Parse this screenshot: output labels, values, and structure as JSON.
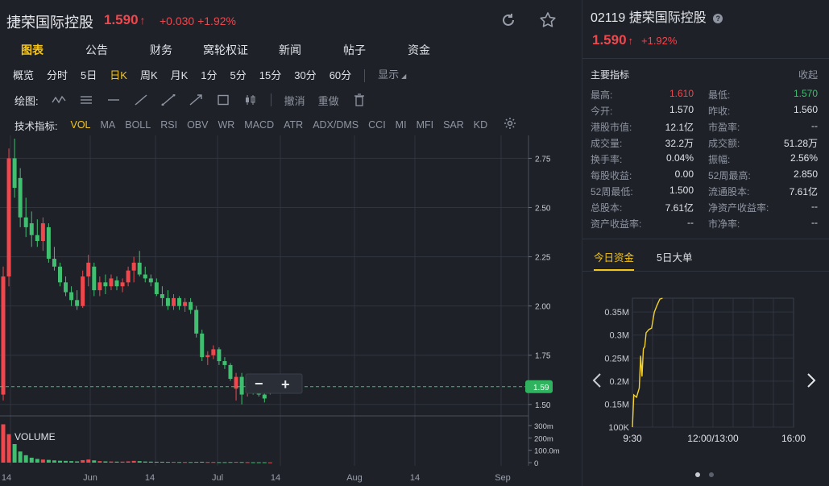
{
  "header": {
    "stock_name": "捷荣国际控股",
    "price": "1.590",
    "price_arrow": "↑",
    "change": "+0.030 +1.92%"
  },
  "main_tabs": [
    {
      "label": "图表",
      "active": true
    },
    {
      "label": "公告"
    },
    {
      "label": "财务"
    },
    {
      "label": "窝轮权证"
    },
    {
      "label": "新闻"
    },
    {
      "label": "帖子"
    },
    {
      "label": "资金"
    }
  ],
  "periods": [
    {
      "label": "概览"
    },
    {
      "label": "分时"
    },
    {
      "label": "5日"
    },
    {
      "label": "日K",
      "active": true
    },
    {
      "label": "周K"
    },
    {
      "label": "月K"
    },
    {
      "label": "1分"
    },
    {
      "label": "5分"
    },
    {
      "label": "15分"
    },
    {
      "label": "30分"
    },
    {
      "label": "60分"
    }
  ],
  "display_label": "显示",
  "draw_bar": {
    "label": "绘图:",
    "undo": "撤消",
    "redo": "重做"
  },
  "indicators": {
    "label": "技术指标:",
    "items": [
      "VOL",
      "MA",
      "BOLL",
      "RSI",
      "OBV",
      "WR",
      "MACD",
      "ATR",
      "ADX/DMS",
      "CCI",
      "MI",
      "MFI",
      "SAR",
      "KD"
    ],
    "active": "VOL"
  },
  "chart": {
    "price_ticks": [
      "2.75",
      "2.50",
      "2.25",
      "2.00",
      "1.75",
      "1.50"
    ],
    "current_price_tag": "1.59",
    "volume_label": "VOLUME",
    "volume_ticks": [
      "300m",
      "200m",
      "100.0m",
      "0"
    ],
    "x_labels": [
      "14",
      "Jun",
      "14",
      "Jul",
      "14",
      "Aug",
      "14",
      "Sep"
    ],
    "zoom_out": "−",
    "zoom_in": "+"
  },
  "chart_data": {
    "type": "candlestick",
    "price_axis": [
      1.45,
      2.85
    ],
    "volume_axis_m": [
      0,
      300
    ],
    "candles": [
      {
        "o": 1.55,
        "h": 2.2,
        "l": 1.52,
        "c": 2.15
      },
      {
        "o": 2.15,
        "h": 2.8,
        "l": 2.1,
        "c": 2.75
      },
      {
        "o": 2.75,
        "h": 2.85,
        "l": 2.55,
        "c": 2.6
      },
      {
        "o": 2.65,
        "h": 2.7,
        "l": 2.4,
        "c": 2.45
      },
      {
        "o": 2.45,
        "h": 2.55,
        "l": 2.35,
        "c": 2.4
      },
      {
        "o": 2.42,
        "h": 2.48,
        "l": 2.3,
        "c": 2.36
      },
      {
        "o": 2.36,
        "h": 2.44,
        "l": 2.3,
        "c": 2.33
      },
      {
        "o": 2.33,
        "h": 2.45,
        "l": 2.28,
        "c": 2.42
      },
      {
        "o": 2.4,
        "h": 2.42,
        "l": 2.22,
        "c": 2.24
      },
      {
        "o": 2.24,
        "h": 2.3,
        "l": 2.18,
        "c": 2.2
      },
      {
        "o": 2.2,
        "h": 2.22,
        "l": 2.1,
        "c": 2.12
      },
      {
        "o": 2.12,
        "h": 2.15,
        "l": 2.05,
        "c": 2.07
      },
      {
        "o": 2.07,
        "h": 2.1,
        "l": 2.0,
        "c": 2.03
      },
      {
        "o": 2.03,
        "h": 2.08,
        "l": 1.98,
        "c": 2.0
      },
      {
        "o": 2.0,
        "h": 2.18,
        "l": 1.99,
        "c": 2.15
      },
      {
        "o": 2.15,
        "h": 2.26,
        "l": 2.1,
        "c": 2.22
      },
      {
        "o": 2.2,
        "h": 2.22,
        "l": 2.05,
        "c": 2.08
      },
      {
        "o": 2.08,
        "h": 2.15,
        "l": 2.05,
        "c": 2.12
      },
      {
        "o": 2.12,
        "h": 2.16,
        "l": 2.06,
        "c": 2.1
      },
      {
        "o": 2.1,
        "h": 2.16,
        "l": 2.08,
        "c": 2.14
      },
      {
        "o": 2.13,
        "h": 2.15,
        "l": 2.08,
        "c": 2.1
      },
      {
        "o": 2.1,
        "h": 2.14,
        "l": 2.07,
        "c": 2.12
      },
      {
        "o": 2.12,
        "h": 2.2,
        "l": 2.1,
        "c": 2.18
      },
      {
        "o": 2.18,
        "h": 2.25,
        "l": 2.12,
        "c": 2.22
      },
      {
        "o": 2.22,
        "h": 2.28,
        "l": 2.15,
        "c": 2.16
      },
      {
        "o": 2.16,
        "h": 2.2,
        "l": 2.12,
        "c": 2.14
      },
      {
        "o": 2.14,
        "h": 2.16,
        "l": 2.1,
        "c": 2.12
      },
      {
        "o": 2.12,
        "h": 2.14,
        "l": 2.05,
        "c": 2.06
      },
      {
        "o": 2.06,
        "h": 2.1,
        "l": 2.0,
        "c": 2.04
      },
      {
        "o": 2.04,
        "h": 2.08,
        "l": 1.98,
        "c": 2.0
      },
      {
        "o": 2.0,
        "h": 2.06,
        "l": 1.98,
        "c": 2.04
      },
      {
        "o": 2.04,
        "h": 2.05,
        "l": 1.98,
        "c": 2.0
      },
      {
        "o": 2.0,
        "h": 2.04,
        "l": 1.97,
        "c": 2.02
      },
      {
        "o": 2.02,
        "h": 2.04,
        "l": 1.96,
        "c": 1.98
      },
      {
        "o": 1.98,
        "h": 2.0,
        "l": 1.84,
        "c": 1.86
      },
      {
        "o": 1.86,
        "h": 1.88,
        "l": 1.72,
        "c": 1.74
      },
      {
        "o": 1.74,
        "h": 1.77,
        "l": 1.7,
        "c": 1.75
      },
      {
        "o": 1.75,
        "h": 1.8,
        "l": 1.73,
        "c": 1.78
      },
      {
        "o": 1.78,
        "h": 1.79,
        "l": 1.7,
        "c": 1.72
      },
      {
        "o": 1.72,
        "h": 1.74,
        "l": 1.68,
        "c": 1.7
      },
      {
        "o": 1.7,
        "h": 1.71,
        "l": 1.62,
        "c": 1.63
      },
      {
        "o": 1.58,
        "h": 1.66,
        "l": 1.52,
        "c": 1.64
      },
      {
        "o": 1.64,
        "h": 1.66,
        "l": 1.5,
        "c": 1.55
      },
      {
        "o": 1.56,
        "h": 1.62,
        "l": 1.54,
        "c": 1.6
      },
      {
        "o": 1.6,
        "h": 1.62,
        "l": 1.55,
        "c": 1.57
      },
      {
        "o": 1.57,
        "h": 1.58,
        "l": 1.54,
        "c": 1.55
      },
      {
        "o": 1.55,
        "h": 1.57,
        "l": 1.51,
        "c": 1.53
      },
      {
        "o": 1.56,
        "h": 1.6,
        "l": 1.55,
        "c": 1.59
      }
    ],
    "volumes_m": [
      310,
      230,
      150,
      90,
      60,
      40,
      30,
      25,
      22,
      18,
      15,
      14,
      12,
      10,
      20,
      25,
      18,
      12,
      10,
      9,
      8,
      8,
      10,
      14,
      12,
      9,
      8,
      7,
      7,
      6,
      6,
      5,
      5,
      5,
      6,
      7,
      5,
      5,
      4,
      4,
      5,
      6,
      5,
      4,
      3,
      3,
      3,
      2
    ]
  },
  "right": {
    "code_name": "02119 捷荣国际控股",
    "price": "1.590",
    "price_arrow": "↑",
    "change": "+1.92%",
    "metrics_title": "主要指标",
    "metrics_collapse": "收起",
    "metrics": [
      [
        {
          "label": "最高:",
          "value": "1.610",
          "tone": "up"
        },
        {
          "label": "最低:",
          "value": "1.570",
          "tone": "down"
        }
      ],
      [
        {
          "label": "今开:",
          "value": "1.570"
        },
        {
          "label": "昨收:",
          "value": "1.560"
        }
      ],
      [
        {
          "label": "港股市值:",
          "value": "12.1亿"
        },
        {
          "label": "市盈率:",
          "value": "--"
        }
      ],
      [
        {
          "label": "成交量:",
          "value": "32.2万"
        },
        {
          "label": "成交额:",
          "value": "51.28万"
        }
      ],
      [
        {
          "label": "换手率:",
          "value": "0.04%"
        },
        {
          "label": "振幅:",
          "value": "2.56%"
        }
      ],
      [
        {
          "label": "每股收益:",
          "value": "0.00"
        },
        {
          "label": "52周最高:",
          "value": "2.850"
        }
      ],
      [
        {
          "label": "52周最低:",
          "value": "1.500"
        },
        {
          "label": "流通股本:",
          "value": "7.61亿"
        }
      ],
      [
        {
          "label": "总股本:",
          "value": "7.61亿"
        },
        {
          "label": "净资产收益率:",
          "value": "--"
        }
      ],
      [
        {
          "label": "资产收益率:",
          "value": "--"
        },
        {
          "label": "市净率:",
          "value": "--"
        }
      ]
    ],
    "fund_tabs": [
      {
        "label": "今日资金",
        "active": true
      },
      {
        "label": "5日大单"
      }
    ],
    "fund_chart": {
      "y_ticks": [
        "0.35M",
        "0.3M",
        "0.25M",
        "0.2M",
        "0.15M",
        "100K"
      ],
      "x_labels": [
        "9:30",
        "12:00/13:00",
        "16:00"
      ]
    }
  },
  "fund_chart_data": {
    "type": "line",
    "y_range": [
      100000,
      380000
    ],
    "points": [
      [
        0,
        100000
      ],
      [
        1,
        170000
      ],
      [
        3,
        165000
      ],
      [
        5,
        185000
      ],
      [
        6,
        255000
      ],
      [
        7,
        210000
      ],
      [
        8,
        270000
      ],
      [
        9,
        275000
      ],
      [
        10,
        305000
      ],
      [
        12,
        312000
      ],
      [
        14,
        315000
      ],
      [
        16,
        350000
      ],
      [
        18,
        365000
      ],
      [
        20,
        378000
      ],
      [
        22,
        390000
      ]
    ]
  },
  "colors": {
    "up": "#f0474d",
    "down": "#3fbf6f",
    "accent": "#f5c518",
    "bg": "#1e2128",
    "grid": "#2c3039"
  }
}
